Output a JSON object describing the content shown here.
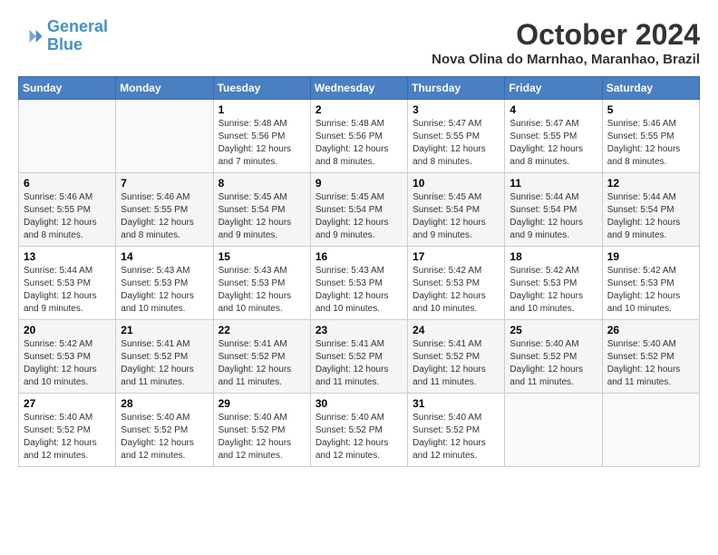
{
  "logo": {
    "line1": "General",
    "line2": "Blue",
    "icon": "▶"
  },
  "title": "October 2024",
  "location": "Nova Olina do Marnhao, Maranhao, Brazil",
  "weekdays": [
    "Sunday",
    "Monday",
    "Tuesday",
    "Wednesday",
    "Thursday",
    "Friday",
    "Saturday"
  ],
  "weeks": [
    [
      {
        "day": "",
        "info": ""
      },
      {
        "day": "",
        "info": ""
      },
      {
        "day": "1",
        "info": "Sunrise: 5:48 AM\nSunset: 5:56 PM\nDaylight: 12 hours\nand 7 minutes."
      },
      {
        "day": "2",
        "info": "Sunrise: 5:48 AM\nSunset: 5:56 PM\nDaylight: 12 hours\nand 8 minutes."
      },
      {
        "day": "3",
        "info": "Sunrise: 5:47 AM\nSunset: 5:55 PM\nDaylight: 12 hours\nand 8 minutes."
      },
      {
        "day": "4",
        "info": "Sunrise: 5:47 AM\nSunset: 5:55 PM\nDaylight: 12 hours\nand 8 minutes."
      },
      {
        "day": "5",
        "info": "Sunrise: 5:46 AM\nSunset: 5:55 PM\nDaylight: 12 hours\nand 8 minutes."
      }
    ],
    [
      {
        "day": "6",
        "info": "Sunrise: 5:46 AM\nSunset: 5:55 PM\nDaylight: 12 hours\nand 8 minutes."
      },
      {
        "day": "7",
        "info": "Sunrise: 5:46 AM\nSunset: 5:55 PM\nDaylight: 12 hours\nand 8 minutes."
      },
      {
        "day": "8",
        "info": "Sunrise: 5:45 AM\nSunset: 5:54 PM\nDaylight: 12 hours\nand 9 minutes."
      },
      {
        "day": "9",
        "info": "Sunrise: 5:45 AM\nSunset: 5:54 PM\nDaylight: 12 hours\nand 9 minutes."
      },
      {
        "day": "10",
        "info": "Sunrise: 5:45 AM\nSunset: 5:54 PM\nDaylight: 12 hours\nand 9 minutes."
      },
      {
        "day": "11",
        "info": "Sunrise: 5:44 AM\nSunset: 5:54 PM\nDaylight: 12 hours\nand 9 minutes."
      },
      {
        "day": "12",
        "info": "Sunrise: 5:44 AM\nSunset: 5:54 PM\nDaylight: 12 hours\nand 9 minutes."
      }
    ],
    [
      {
        "day": "13",
        "info": "Sunrise: 5:44 AM\nSunset: 5:53 PM\nDaylight: 12 hours\nand 9 minutes."
      },
      {
        "day": "14",
        "info": "Sunrise: 5:43 AM\nSunset: 5:53 PM\nDaylight: 12 hours\nand 10 minutes."
      },
      {
        "day": "15",
        "info": "Sunrise: 5:43 AM\nSunset: 5:53 PM\nDaylight: 12 hours\nand 10 minutes."
      },
      {
        "day": "16",
        "info": "Sunrise: 5:43 AM\nSunset: 5:53 PM\nDaylight: 12 hours\nand 10 minutes."
      },
      {
        "day": "17",
        "info": "Sunrise: 5:42 AM\nSunset: 5:53 PM\nDaylight: 12 hours\nand 10 minutes."
      },
      {
        "day": "18",
        "info": "Sunrise: 5:42 AM\nSunset: 5:53 PM\nDaylight: 12 hours\nand 10 minutes."
      },
      {
        "day": "19",
        "info": "Sunrise: 5:42 AM\nSunset: 5:53 PM\nDaylight: 12 hours\nand 10 minutes."
      }
    ],
    [
      {
        "day": "20",
        "info": "Sunrise: 5:42 AM\nSunset: 5:53 PM\nDaylight: 12 hours\nand 10 minutes."
      },
      {
        "day": "21",
        "info": "Sunrise: 5:41 AM\nSunset: 5:52 PM\nDaylight: 12 hours\nand 11 minutes."
      },
      {
        "day": "22",
        "info": "Sunrise: 5:41 AM\nSunset: 5:52 PM\nDaylight: 12 hours\nand 11 minutes."
      },
      {
        "day": "23",
        "info": "Sunrise: 5:41 AM\nSunset: 5:52 PM\nDaylight: 12 hours\nand 11 minutes."
      },
      {
        "day": "24",
        "info": "Sunrise: 5:41 AM\nSunset: 5:52 PM\nDaylight: 12 hours\nand 11 minutes."
      },
      {
        "day": "25",
        "info": "Sunrise: 5:40 AM\nSunset: 5:52 PM\nDaylight: 12 hours\nand 11 minutes."
      },
      {
        "day": "26",
        "info": "Sunrise: 5:40 AM\nSunset: 5:52 PM\nDaylight: 12 hours\nand 11 minutes."
      }
    ],
    [
      {
        "day": "27",
        "info": "Sunrise: 5:40 AM\nSunset: 5:52 PM\nDaylight: 12 hours\nand 12 minutes."
      },
      {
        "day": "28",
        "info": "Sunrise: 5:40 AM\nSunset: 5:52 PM\nDaylight: 12 hours\nand 12 minutes."
      },
      {
        "day": "29",
        "info": "Sunrise: 5:40 AM\nSunset: 5:52 PM\nDaylight: 12 hours\nand 12 minutes."
      },
      {
        "day": "30",
        "info": "Sunrise: 5:40 AM\nSunset: 5:52 PM\nDaylight: 12 hours\nand 12 minutes."
      },
      {
        "day": "31",
        "info": "Sunrise: 5:40 AM\nSunset: 5:52 PM\nDaylight: 12 hours\nand 12 minutes."
      },
      {
        "day": "",
        "info": ""
      },
      {
        "day": "",
        "info": ""
      }
    ]
  ]
}
